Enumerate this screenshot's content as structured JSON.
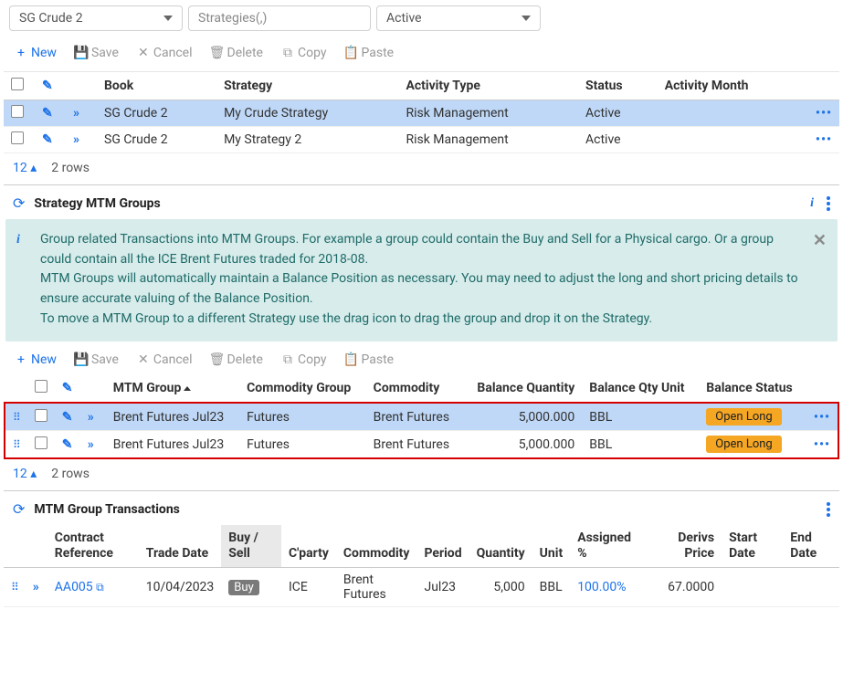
{
  "filters": {
    "book": "SG Crude 2",
    "strategies_placeholder": "Strategies(,)",
    "status": "Active"
  },
  "toolbar": {
    "new": "New",
    "save": "Save",
    "cancel": "Cancel",
    "delete": "Delete",
    "copy": "Copy",
    "paste": "Paste"
  },
  "strategies_table": {
    "headers": {
      "book": "Book",
      "strategy": "Strategy",
      "activity_type": "Activity Type",
      "status": "Status",
      "activity_month": "Activity Month"
    },
    "rows": [
      {
        "book": "SG Crude 2",
        "strategy": "My Crude Strategy",
        "activity_type": "Risk Management",
        "status": "Active",
        "activity_month": ""
      },
      {
        "book": "SG Crude 2",
        "strategy": "My Strategy 2",
        "activity_type": "Risk Management",
        "status": "Active",
        "activity_month": ""
      }
    ]
  },
  "pager": {
    "size": "12",
    "rows": "2 rows"
  },
  "mtm_panel": {
    "title": "Strategy MTM Groups",
    "info_p1": "Group related Transactions into MTM Groups. For example a group could contain the Buy and Sell for a Physical cargo. Or a group could contain all the ICE Brent Futures traded for 2018-08.",
    "info_p2": "MTM Groups will automatically maintain a Balance Position as necessary. You may need to adjust the long and short pricing details to ensure accurate valuing of the Balance Position.",
    "info_p3": "To move a MTM Group to a different Strategy use the drag icon to drag the group and drop it on the Strategy."
  },
  "mtm_table": {
    "headers": {
      "mtm_group": "MTM Group",
      "commodity_group": "Commodity Group",
      "commodity": "Commodity",
      "balance_qty": "Balance Quantity",
      "balance_unit": "Balance Qty Unit",
      "balance_status": "Balance Status"
    },
    "rows": [
      {
        "mtm_group": "Brent Futures Jul23",
        "commodity_group": "Futures",
        "commodity": "Brent Futures",
        "balance_qty": "5,000.000",
        "balance_unit": "BBL",
        "balance_status": "Open Long"
      },
      {
        "mtm_group": "Brent Futures Jul23",
        "commodity_group": "Futures",
        "commodity": "Brent Futures",
        "balance_qty": "5,000.000",
        "balance_unit": "BBL",
        "balance_status": "Open Long"
      }
    ]
  },
  "txn_panel": {
    "title": "MTM Group Transactions"
  },
  "txn_table": {
    "headers": {
      "contract_ref": "Contract Reference",
      "trade_date": "Trade Date",
      "buy_sell": "Buy / Sell",
      "cparty": "C'party",
      "commodity": "Commodity",
      "period": "Period",
      "quantity": "Quantity",
      "unit": "Unit",
      "assigned_pct": "Assigned %",
      "derivs_price": "Derivs Price",
      "start_date": "Start Date",
      "end_date": "End Date"
    },
    "rows": [
      {
        "contract_ref": "AA005",
        "trade_date": "10/04/2023",
        "buy_sell": "Buy",
        "cparty": "ICE",
        "commodity": "Brent Futures",
        "period": "Jul23",
        "quantity": "5,000",
        "unit": "BBL",
        "assigned_pct": "100.00%",
        "derivs_price": "67.0000",
        "start_date": "",
        "end_date": ""
      }
    ]
  }
}
